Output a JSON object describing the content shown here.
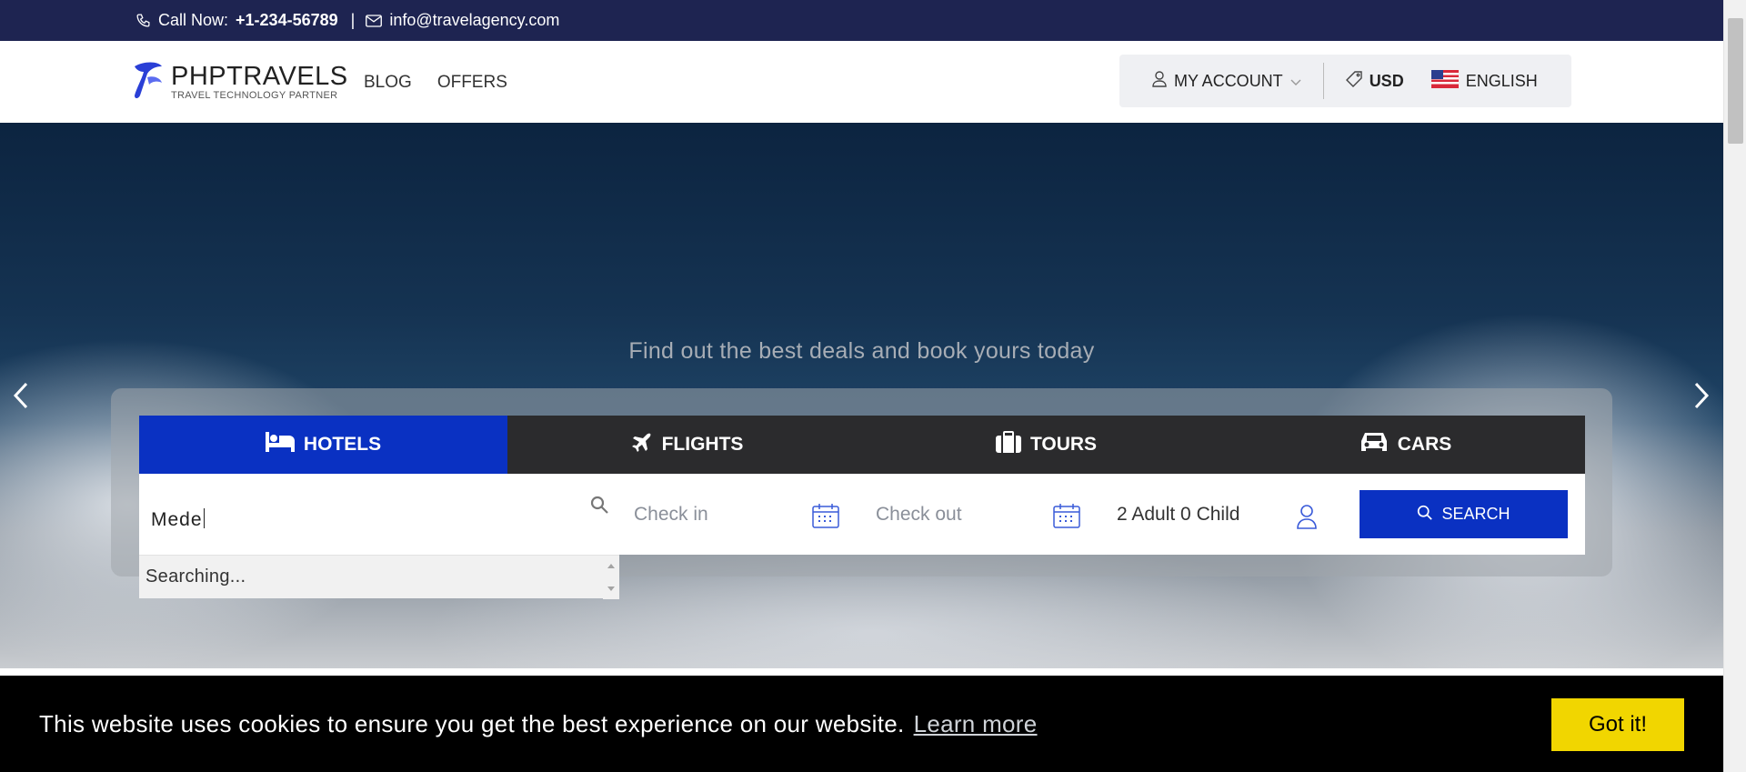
{
  "topbar": {
    "call_label": "Call Now:",
    "phone": "+1-234-56789",
    "separator": "|",
    "email": "info@travelagency.com"
  },
  "header": {
    "logo_title": "PHPTRAVELS",
    "logo_subtitle": "TRAVEL TECHNOLOGY PARTNER",
    "nav": [
      "BLOG",
      "OFFERS"
    ],
    "account_label": "MY ACCOUNT",
    "currency": "USD",
    "language": "ENGLISH"
  },
  "hero": {
    "subtitle": "Find out the best deals and book yours today"
  },
  "search": {
    "tabs": [
      "HOTELS",
      "FLIGHTS",
      "TOURS",
      "CARS"
    ],
    "active_tab": "HOTELS",
    "destination_value": "Mede",
    "checkin_placeholder": "Check in",
    "checkout_placeholder": "Check out",
    "guests": "2 Adult 0 Child",
    "search_button": "SEARCH",
    "dropdown_status": "Searching..."
  },
  "cookie": {
    "message": "This website uses cookies to ensure you get the best experience on our website.",
    "learn_more": "Learn more",
    "accept": "Got it!"
  },
  "colors": {
    "topbar": "#1e2451",
    "brand_blue": "#0a31c2",
    "tab_bar": "#2b2b2d",
    "cookie_bg": "#000000",
    "cookie_button": "#f1d600"
  }
}
